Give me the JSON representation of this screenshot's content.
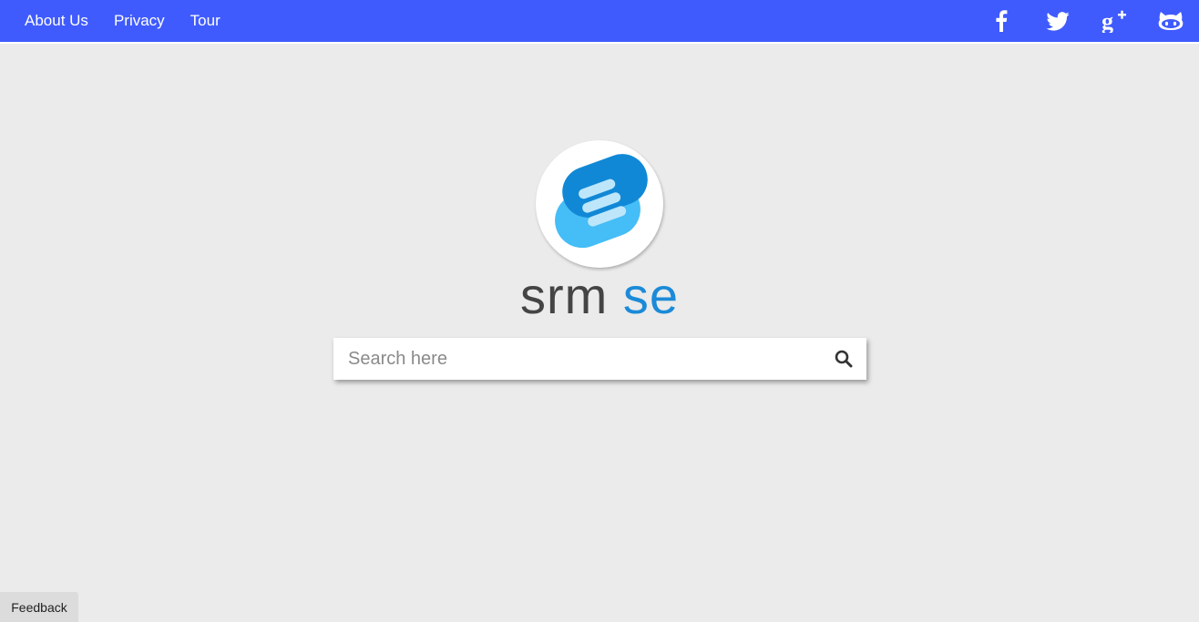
{
  "nav": {
    "links": [
      {
        "label": "About Us"
      },
      {
        "label": "Privacy"
      },
      {
        "label": "Tour"
      }
    ],
    "social": [
      {
        "icon": "facebook-icon"
      },
      {
        "icon": "twitter-icon"
      },
      {
        "icon": "google-plus-icon"
      },
      {
        "icon": "github-icon"
      }
    ],
    "bar_color": "#3f5bfe"
  },
  "brand": {
    "part1": "srm",
    "part2": "se",
    "color1": "#444444",
    "color2": "#1b8ad8"
  },
  "search": {
    "placeholder": "Search here",
    "value": "",
    "icon": "search-icon"
  },
  "feedback": {
    "label": "Feedback"
  }
}
